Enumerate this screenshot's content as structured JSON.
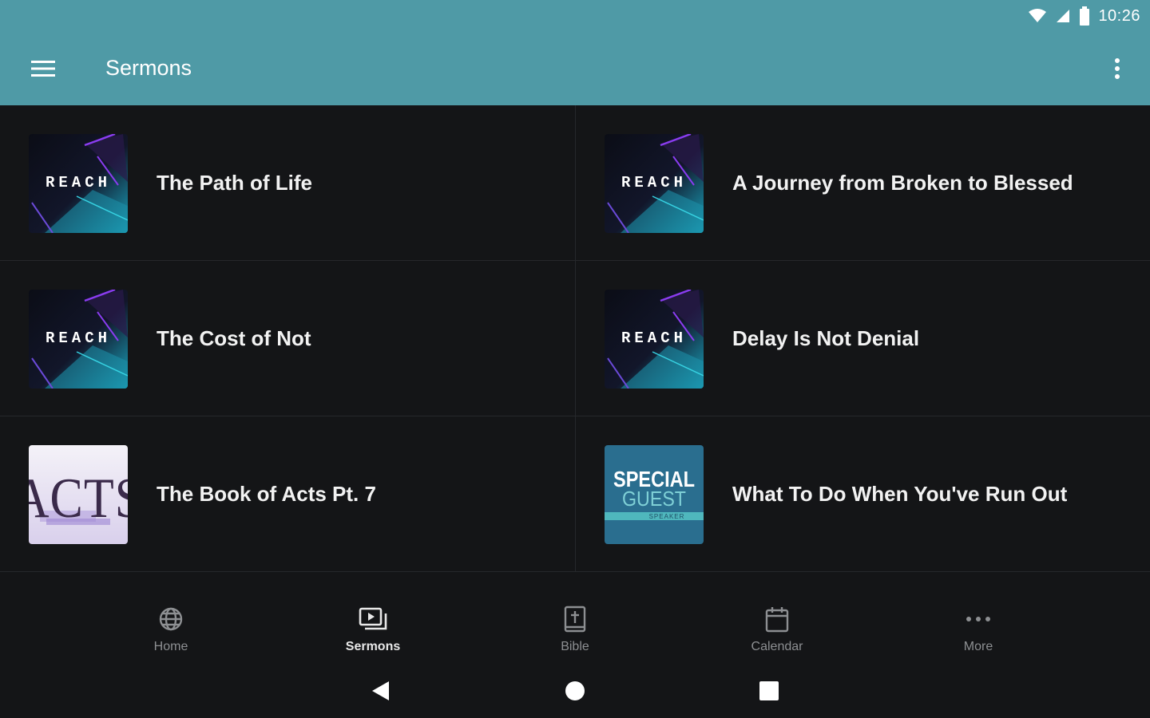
{
  "status_bar": {
    "time": "10:26"
  },
  "app_bar": {
    "title": "Sermons"
  },
  "sermons": [
    {
      "title": "The Path of Life",
      "artwork": "reach"
    },
    {
      "title": "A Journey from Broken to Blessed",
      "artwork": "reach"
    },
    {
      "title": "The Cost of Not",
      "artwork": "reach"
    },
    {
      "title": "Delay Is Not Denial",
      "artwork": "reach"
    },
    {
      "title": "The Book of Acts Pt. 7",
      "artwork": "acts"
    },
    {
      "title": "What To Do When You've Run Out",
      "artwork": "special-guest"
    }
  ],
  "artwork_text": {
    "reach": "REACH",
    "acts": "ACTS",
    "special": "SPECIAL",
    "guest": "GUEST",
    "speaker": "SPEAKER"
  },
  "bottom_nav": {
    "active": "Sermons",
    "items": [
      {
        "label": "Home",
        "icon": "globe-icon"
      },
      {
        "label": "Sermons",
        "icon": "video-library-icon"
      },
      {
        "label": "Bible",
        "icon": "bible-icon"
      },
      {
        "label": "Calendar",
        "icon": "calendar-icon"
      },
      {
        "label": "More",
        "icon": "more-horizontal-icon"
      }
    ]
  },
  "colors": {
    "app_bar": "#4f9aa6",
    "background": "#141517",
    "reach_accent": "#8a3cf0",
    "reach_teal": "#1fb8c9",
    "special_guest_blue": "#2a6e8f"
  }
}
